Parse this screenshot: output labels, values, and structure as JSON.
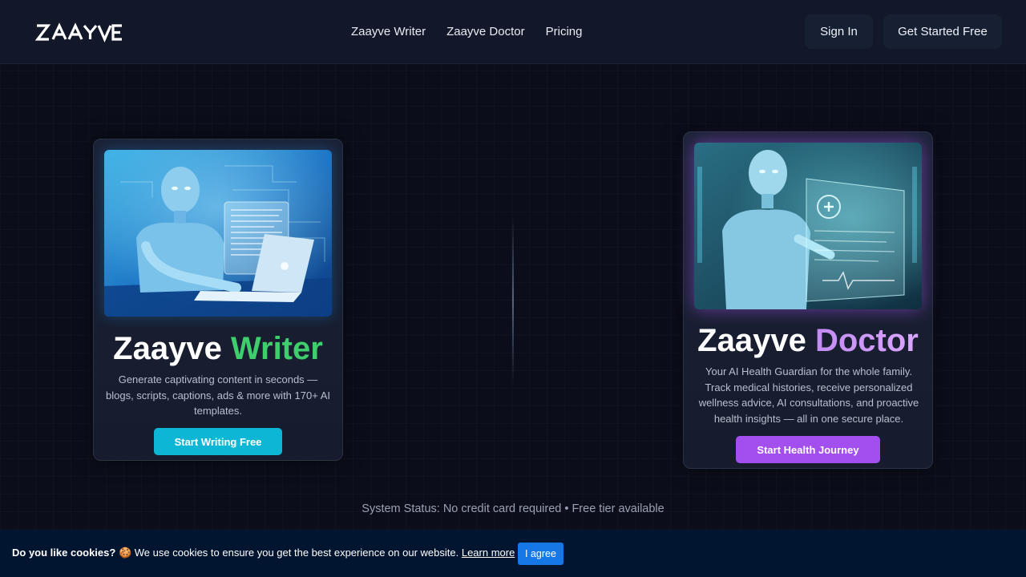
{
  "header": {
    "logo": "ZAAYVE",
    "nav": [
      "Zaayve Writer",
      "Zaayve Doctor",
      "Pricing"
    ],
    "sign_in": "Sign In",
    "get_started": "Get Started Free"
  },
  "writer_card": {
    "title_main": "Zaayve",
    "title_accent": "Writer",
    "description": "Generate captivating content in seconds — blogs, scripts, captions, ads & more with 170+ AI templates.",
    "cta": "Start Writing Free",
    "accent_color": "#3ecf6c",
    "button_color": "#0eb6d6"
  },
  "doctor_card": {
    "title_main": "Zaayve",
    "title_accent": "Doctor",
    "description": "Your AI Health Guardian for the whole family. Track medical histories, receive personalized wellness advice, AI consultations, and proactive health insights — all in one secure place.",
    "cta": "Start Health Journey",
    "accent_color": "#c38bf5",
    "button_color": "#a34ff0"
  },
  "status": "System Status: No credit card required • Free tier available",
  "cookie": {
    "question": "Do you like cookies?",
    "emoji": "🍪",
    "message": "We use cookies to ensure you get the best experience on our website.",
    "learn_more": "Learn more",
    "agree": "I agree"
  }
}
